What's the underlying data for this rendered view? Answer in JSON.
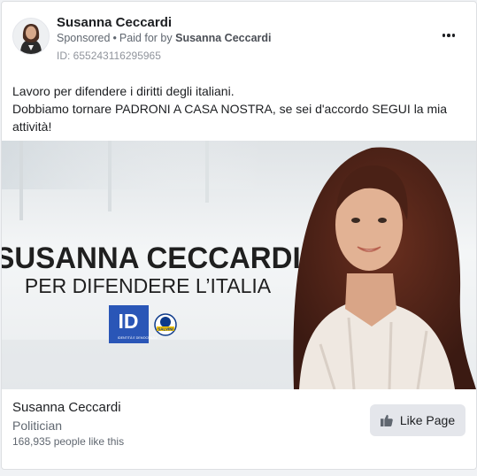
{
  "post": {
    "page_name": "Susanna Ceccardi",
    "sponsored_label": "Sponsored",
    "separator": "•",
    "paid_for_prefix": "Paid for by",
    "paid_for_by": "Susanna Ceccardi",
    "ad_id": "ID: 655243116295965",
    "message_lines": [
      "Lavoro per difendere i diritti degli italiani.",
      "Dobbiamo tornare PADRONI A CASA NOSTRA, se sei d'accordo SEGUI la mia attività!"
    ]
  },
  "creative": {
    "headline": "SUSANNA CECCARDI",
    "subheadline": "PER DIFENDERE L’ITALIA",
    "logo_id_letters": "ID",
    "logo_id_caption": "IDENTITÀ E DEMOCRAZIA",
    "logo_lega_text": "SALVINI"
  },
  "footer": {
    "page_name": "Susanna Ceccardi",
    "category": "Politician",
    "likes": "168,935 people like this",
    "like_button_label": "Like Page"
  },
  "colors": {
    "id_logo_blue": "#2a56b7",
    "lega_blue": "#0d3a8a",
    "button_bg": "#e4e6eb"
  },
  "icons": {
    "more": "more-options-icon",
    "like": "thumbs-up-icon"
  }
}
